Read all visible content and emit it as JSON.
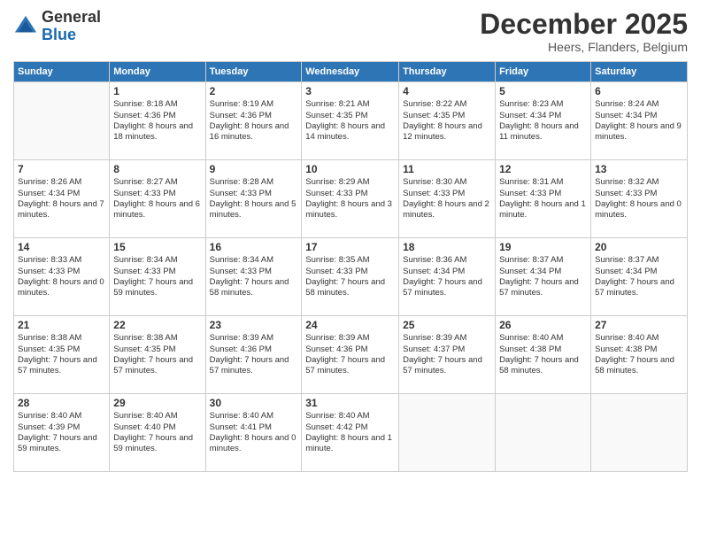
{
  "logo": {
    "general": "General",
    "blue": "Blue"
  },
  "header": {
    "month": "December 2025",
    "location": "Heers, Flanders, Belgium"
  },
  "weekdays": [
    "Sunday",
    "Monday",
    "Tuesday",
    "Wednesday",
    "Thursday",
    "Friday",
    "Saturday"
  ],
  "weeks": [
    [
      {
        "day": "",
        "sunrise": "",
        "sunset": "",
        "daylight": ""
      },
      {
        "day": "1",
        "sunrise": "Sunrise: 8:18 AM",
        "sunset": "Sunset: 4:36 PM",
        "daylight": "Daylight: 8 hours and 18 minutes."
      },
      {
        "day": "2",
        "sunrise": "Sunrise: 8:19 AM",
        "sunset": "Sunset: 4:36 PM",
        "daylight": "Daylight: 8 hours and 16 minutes."
      },
      {
        "day": "3",
        "sunrise": "Sunrise: 8:21 AM",
        "sunset": "Sunset: 4:35 PM",
        "daylight": "Daylight: 8 hours and 14 minutes."
      },
      {
        "day": "4",
        "sunrise": "Sunrise: 8:22 AM",
        "sunset": "Sunset: 4:35 PM",
        "daylight": "Daylight: 8 hours and 12 minutes."
      },
      {
        "day": "5",
        "sunrise": "Sunrise: 8:23 AM",
        "sunset": "Sunset: 4:34 PM",
        "daylight": "Daylight: 8 hours and 11 minutes."
      },
      {
        "day": "6",
        "sunrise": "Sunrise: 8:24 AM",
        "sunset": "Sunset: 4:34 PM",
        "daylight": "Daylight: 8 hours and 9 minutes."
      }
    ],
    [
      {
        "day": "7",
        "sunrise": "Sunrise: 8:26 AM",
        "sunset": "Sunset: 4:34 PM",
        "daylight": "Daylight: 8 hours and 7 minutes."
      },
      {
        "day": "8",
        "sunrise": "Sunrise: 8:27 AM",
        "sunset": "Sunset: 4:33 PM",
        "daylight": "Daylight: 8 hours and 6 minutes."
      },
      {
        "day": "9",
        "sunrise": "Sunrise: 8:28 AM",
        "sunset": "Sunset: 4:33 PM",
        "daylight": "Daylight: 8 hours and 5 minutes."
      },
      {
        "day": "10",
        "sunrise": "Sunrise: 8:29 AM",
        "sunset": "Sunset: 4:33 PM",
        "daylight": "Daylight: 8 hours and 3 minutes."
      },
      {
        "day": "11",
        "sunrise": "Sunrise: 8:30 AM",
        "sunset": "Sunset: 4:33 PM",
        "daylight": "Daylight: 8 hours and 2 minutes."
      },
      {
        "day": "12",
        "sunrise": "Sunrise: 8:31 AM",
        "sunset": "Sunset: 4:33 PM",
        "daylight": "Daylight: 8 hours and 1 minute."
      },
      {
        "day": "13",
        "sunrise": "Sunrise: 8:32 AM",
        "sunset": "Sunset: 4:33 PM",
        "daylight": "Daylight: 8 hours and 0 minutes."
      }
    ],
    [
      {
        "day": "14",
        "sunrise": "Sunrise: 8:33 AM",
        "sunset": "Sunset: 4:33 PM",
        "daylight": "Daylight: 8 hours and 0 minutes."
      },
      {
        "day": "15",
        "sunrise": "Sunrise: 8:34 AM",
        "sunset": "Sunset: 4:33 PM",
        "daylight": "Daylight: 7 hours and 59 minutes."
      },
      {
        "day": "16",
        "sunrise": "Sunrise: 8:34 AM",
        "sunset": "Sunset: 4:33 PM",
        "daylight": "Daylight: 7 hours and 58 minutes."
      },
      {
        "day": "17",
        "sunrise": "Sunrise: 8:35 AM",
        "sunset": "Sunset: 4:33 PM",
        "daylight": "Daylight: 7 hours and 58 minutes."
      },
      {
        "day": "18",
        "sunrise": "Sunrise: 8:36 AM",
        "sunset": "Sunset: 4:34 PM",
        "daylight": "Daylight: 7 hours and 57 minutes."
      },
      {
        "day": "19",
        "sunrise": "Sunrise: 8:37 AM",
        "sunset": "Sunset: 4:34 PM",
        "daylight": "Daylight: 7 hours and 57 minutes."
      },
      {
        "day": "20",
        "sunrise": "Sunrise: 8:37 AM",
        "sunset": "Sunset: 4:34 PM",
        "daylight": "Daylight: 7 hours and 57 minutes."
      }
    ],
    [
      {
        "day": "21",
        "sunrise": "Sunrise: 8:38 AM",
        "sunset": "Sunset: 4:35 PM",
        "daylight": "Daylight: 7 hours and 57 minutes."
      },
      {
        "day": "22",
        "sunrise": "Sunrise: 8:38 AM",
        "sunset": "Sunset: 4:35 PM",
        "daylight": "Daylight: 7 hours and 57 minutes."
      },
      {
        "day": "23",
        "sunrise": "Sunrise: 8:39 AM",
        "sunset": "Sunset: 4:36 PM",
        "daylight": "Daylight: 7 hours and 57 minutes."
      },
      {
        "day": "24",
        "sunrise": "Sunrise: 8:39 AM",
        "sunset": "Sunset: 4:36 PM",
        "daylight": "Daylight: 7 hours and 57 minutes."
      },
      {
        "day": "25",
        "sunrise": "Sunrise: 8:39 AM",
        "sunset": "Sunset: 4:37 PM",
        "daylight": "Daylight: 7 hours and 57 minutes."
      },
      {
        "day": "26",
        "sunrise": "Sunrise: 8:40 AM",
        "sunset": "Sunset: 4:38 PM",
        "daylight": "Daylight: 7 hours and 58 minutes."
      },
      {
        "day": "27",
        "sunrise": "Sunrise: 8:40 AM",
        "sunset": "Sunset: 4:38 PM",
        "daylight": "Daylight: 7 hours and 58 minutes."
      }
    ],
    [
      {
        "day": "28",
        "sunrise": "Sunrise: 8:40 AM",
        "sunset": "Sunset: 4:39 PM",
        "daylight": "Daylight: 7 hours and 59 minutes."
      },
      {
        "day": "29",
        "sunrise": "Sunrise: 8:40 AM",
        "sunset": "Sunset: 4:40 PM",
        "daylight": "Daylight: 7 hours and 59 minutes."
      },
      {
        "day": "30",
        "sunrise": "Sunrise: 8:40 AM",
        "sunset": "Sunset: 4:41 PM",
        "daylight": "Daylight: 8 hours and 0 minutes."
      },
      {
        "day": "31",
        "sunrise": "Sunrise: 8:40 AM",
        "sunset": "Sunset: 4:42 PM",
        "daylight": "Daylight: 8 hours and 1 minute."
      },
      {
        "day": "",
        "sunrise": "",
        "sunset": "",
        "daylight": ""
      },
      {
        "day": "",
        "sunrise": "",
        "sunset": "",
        "daylight": ""
      },
      {
        "day": "",
        "sunrise": "",
        "sunset": "",
        "daylight": ""
      }
    ]
  ]
}
